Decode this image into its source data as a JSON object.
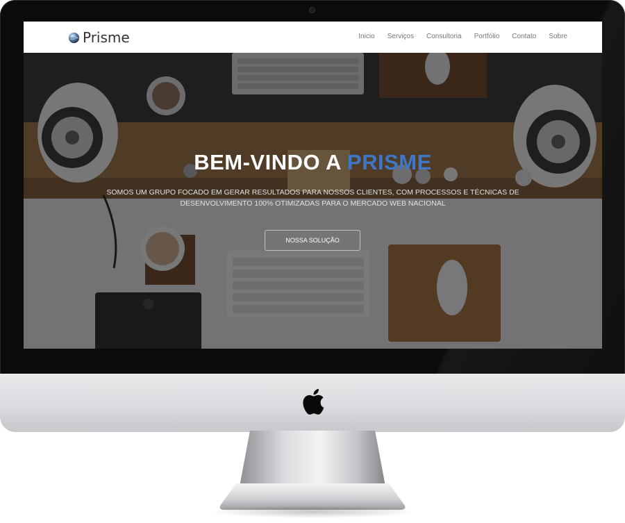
{
  "brand": {
    "name": "Prisme",
    "logo_icon": "globe-icon"
  },
  "nav": {
    "items": [
      {
        "label": "Inicio"
      },
      {
        "label": "Serviços"
      },
      {
        "label": "Consultoria"
      },
      {
        "label": "Portfólio"
      },
      {
        "label": "Contato"
      },
      {
        "label": "Sobre"
      }
    ]
  },
  "hero": {
    "title_prefix": "BEM-VINDO A",
    "title_accent": "PRISME",
    "subtitle": "SOMOS UM GRUPO FOCADO EM GERAR RESULTADOS PARA NOSSOS CLIENTES, COM PROCESSOS E TÉCNICAS DE DESENVOLVIMENTO 100% OTIMIZADAS PARA O MERCADO WEB NACIONAL",
    "button_label": "NOSSA SOLUÇÃO",
    "slides": 3,
    "active_slide": 1
  },
  "colors": {
    "accent": "#3f77c7",
    "nav_text": "#777777",
    "brand_text": "#333333"
  },
  "device": {
    "logo_icon": "apple-icon"
  }
}
